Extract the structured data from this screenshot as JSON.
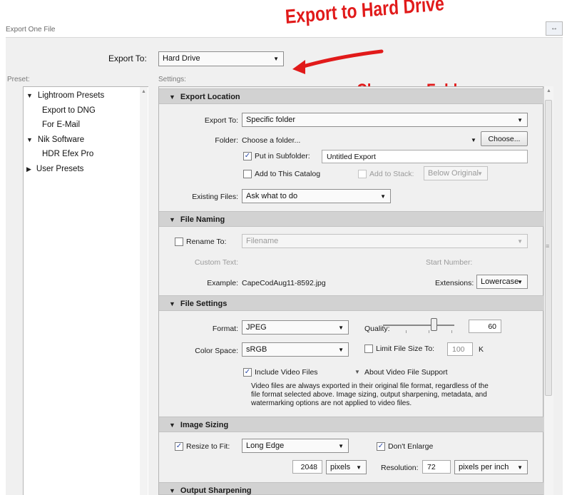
{
  "window": {
    "title": "Export One File",
    "close_glyph": "↔"
  },
  "annotations": {
    "export_hard_drive": "Export to Hard Drive",
    "choose_folder": "Choose a Folder",
    "color": "#e11a1a"
  },
  "export_to": {
    "label": "Export To:",
    "value": "Hard Drive"
  },
  "preset": {
    "label": "Preset:",
    "items": [
      {
        "label": "Lightroom Presets",
        "tri": "▼"
      },
      {
        "label": "Export to DNG"
      },
      {
        "label": "For E-Mail"
      },
      {
        "label": "Nik Software",
        "tri": "▼"
      },
      {
        "label": "HDR Efex Pro"
      },
      {
        "label": "User Presets",
        "tri": "▶"
      }
    ]
  },
  "settings": {
    "label": "Settings:",
    "export_location": {
      "header": "Export Location",
      "export_to_label": "Export To:",
      "export_to_value": "Specific folder",
      "folder_label": "Folder:",
      "folder_value": "Choose a folder...",
      "choose_button": "Choose...",
      "put_in_subfolder_label": "Put in Subfolder:",
      "put_in_subfolder_checked": true,
      "subfolder_value": "Untitled Export",
      "add_to_catalog_label": "Add to This Catalog",
      "add_to_stack_label": "Add to Stack:",
      "stack_position": "Below Original",
      "existing_files_label": "Existing Files:",
      "existing_files_value": "Ask what to do"
    },
    "file_naming": {
      "header": "File Naming",
      "rename_to_label": "Rename To:",
      "rename_to_value": "Filename",
      "custom_text_label": "Custom Text:",
      "start_number_label": "Start Number:",
      "example_label": "Example:",
      "example_value": "CapeCodAug11-8592.jpg",
      "extensions_label": "Extensions:",
      "extensions_value": "Lowercase"
    },
    "file_settings": {
      "header": "File Settings",
      "format_label": "Format:",
      "format_value": "JPEG",
      "quality_label": "Quality:",
      "quality_value": "60",
      "color_space_label": "Color Space:",
      "color_space_value": "sRGB",
      "limit_size_label": "Limit File Size To:",
      "limit_size_value": "100",
      "limit_size_unit": "K",
      "include_video_label": "Include Video Files",
      "about_video_label": "About Video File Support",
      "video_note_1": "Video files are always exported in their original file format, regardless of the",
      "video_note_2": "file format selected above. Image sizing, output sharpening, metadata, and",
      "video_note_3": "watermarking options are not applied to video files."
    },
    "image_sizing": {
      "header": "Image Sizing",
      "resize_label": "Resize to Fit:",
      "resize_value": "Long Edge",
      "dont_enlarge_label": "Don't Enlarge",
      "size_value": "2048",
      "size_unit": "pixels",
      "resolution_label": "Resolution:",
      "resolution_value": "72",
      "resolution_unit": "pixels per inch"
    },
    "output_sharpening": {
      "header": "Output Sharpening"
    }
  }
}
